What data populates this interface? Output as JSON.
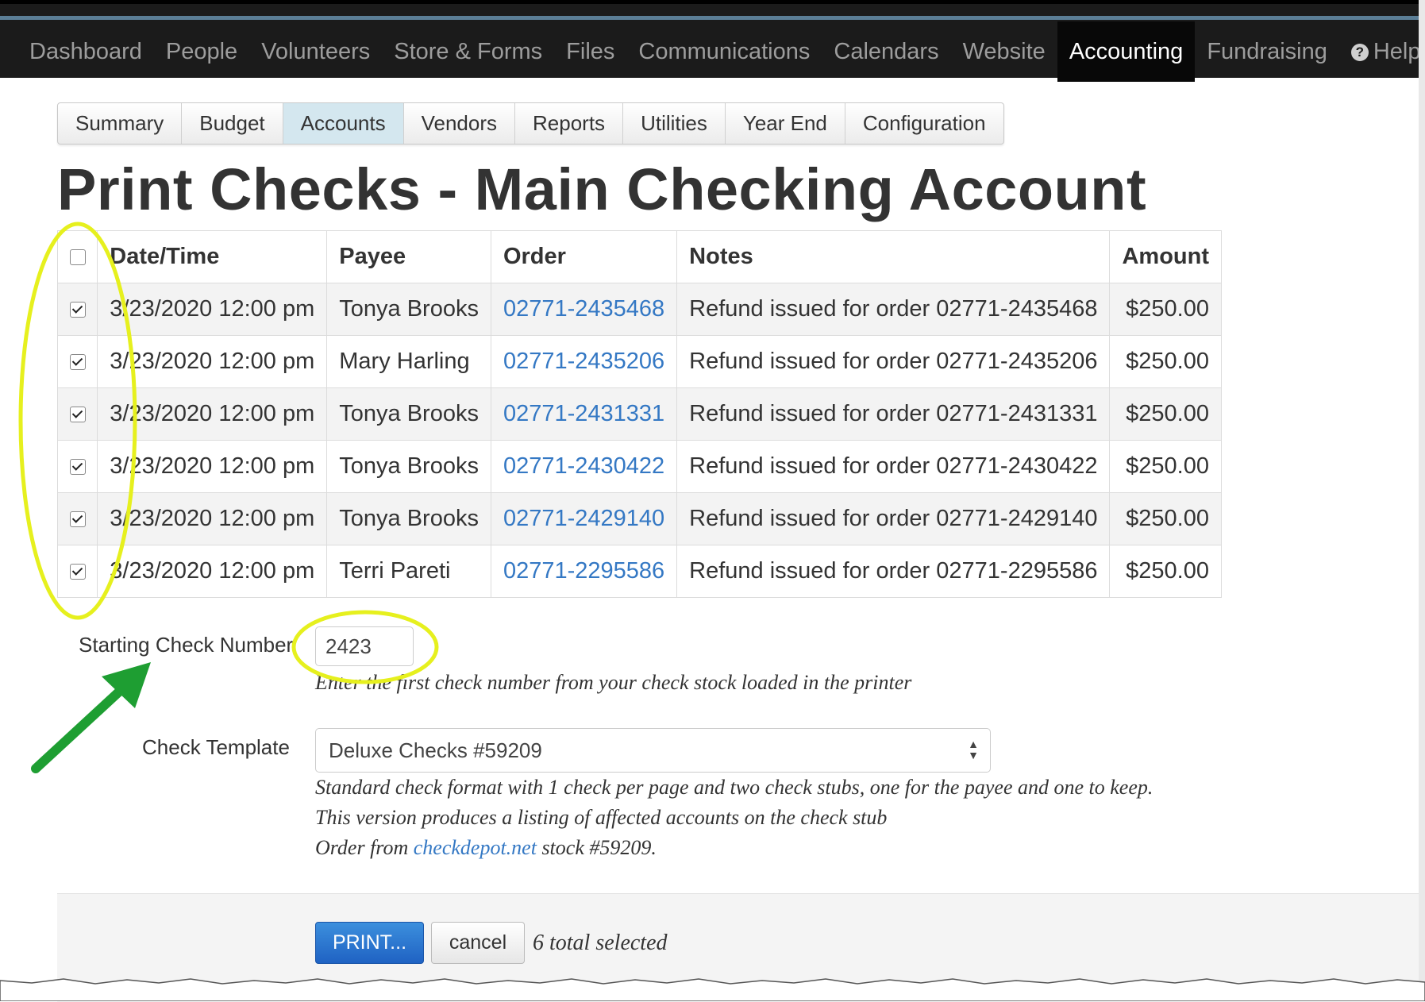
{
  "nav": {
    "items": [
      "Dashboard",
      "People",
      "Volunteers",
      "Store & Forms",
      "Files",
      "Communications",
      "Calendars",
      "Website",
      "Accounting",
      "Fundraising"
    ],
    "active": "Accounting",
    "help_label": "Help",
    "help_icon": "question-circle-icon"
  },
  "tabs": {
    "items": [
      "Summary",
      "Budget",
      "Accounts",
      "Vendors",
      "Reports",
      "Utilities",
      "Year End",
      "Configuration"
    ],
    "active": "Accounts"
  },
  "page_title": "Print Checks - Main Checking Account",
  "table": {
    "headers": [
      "Date/Time",
      "Payee",
      "Order",
      "Notes",
      "Amount"
    ],
    "rows": [
      {
        "checked": true,
        "datetime": "3/23/2020 12:00 pm",
        "payee": "Tonya Brooks",
        "order": "02771-2435468",
        "notes": "Refund issued for order 02771-2435468",
        "amount": "$250.00"
      },
      {
        "checked": true,
        "datetime": "3/23/2020 12:00 pm",
        "payee": "Mary Harling",
        "order": "02771-2435206",
        "notes": "Refund issued for order 02771-2435206",
        "amount": "$250.00"
      },
      {
        "checked": true,
        "datetime": "3/23/2020 12:00 pm",
        "payee": "Tonya Brooks",
        "order": "02771-2431331",
        "notes": "Refund issued for order 02771-2431331",
        "amount": "$250.00"
      },
      {
        "checked": true,
        "datetime": "3/23/2020 12:00 pm",
        "payee": "Tonya Brooks",
        "order": "02771-2430422",
        "notes": "Refund issued for order 02771-2430422",
        "amount": "$250.00"
      },
      {
        "checked": true,
        "datetime": "3/23/2020 12:00 pm",
        "payee": "Tonya Brooks",
        "order": "02771-2429140",
        "notes": "Refund issued for order 02771-2429140",
        "amount": "$250.00"
      },
      {
        "checked": true,
        "datetime": "3/23/2020 12:00 pm",
        "payee": "Terri Pareti",
        "order": "02771-2295586",
        "notes": "Refund issued for order 02771-2295586",
        "amount": "$250.00"
      }
    ]
  },
  "form": {
    "starting_check_label": "Starting Check Number",
    "starting_check_value": "2423",
    "starting_check_help": "Enter the first check number from your check stock loaded in the printer",
    "template_label": "Check Template",
    "template_value": "Deluxe Checks #59209",
    "template_help_1": "Standard check format with 1 check per page and two check stubs, one for the payee and one to keep.",
    "template_help_2": "This version produces a listing of affected accounts on the check stub",
    "template_help_3_prefix": "Order from",
    "template_help_3_link": "checkdepot.net",
    "template_help_3_suffix": "stock #59209."
  },
  "footer": {
    "print_label": "PRINT...",
    "cancel_label": "cancel",
    "selected_text": "6 total selected"
  },
  "annotations": {
    "highlight_color": "#e6f01e",
    "arrow_color": "#1e9e32"
  }
}
